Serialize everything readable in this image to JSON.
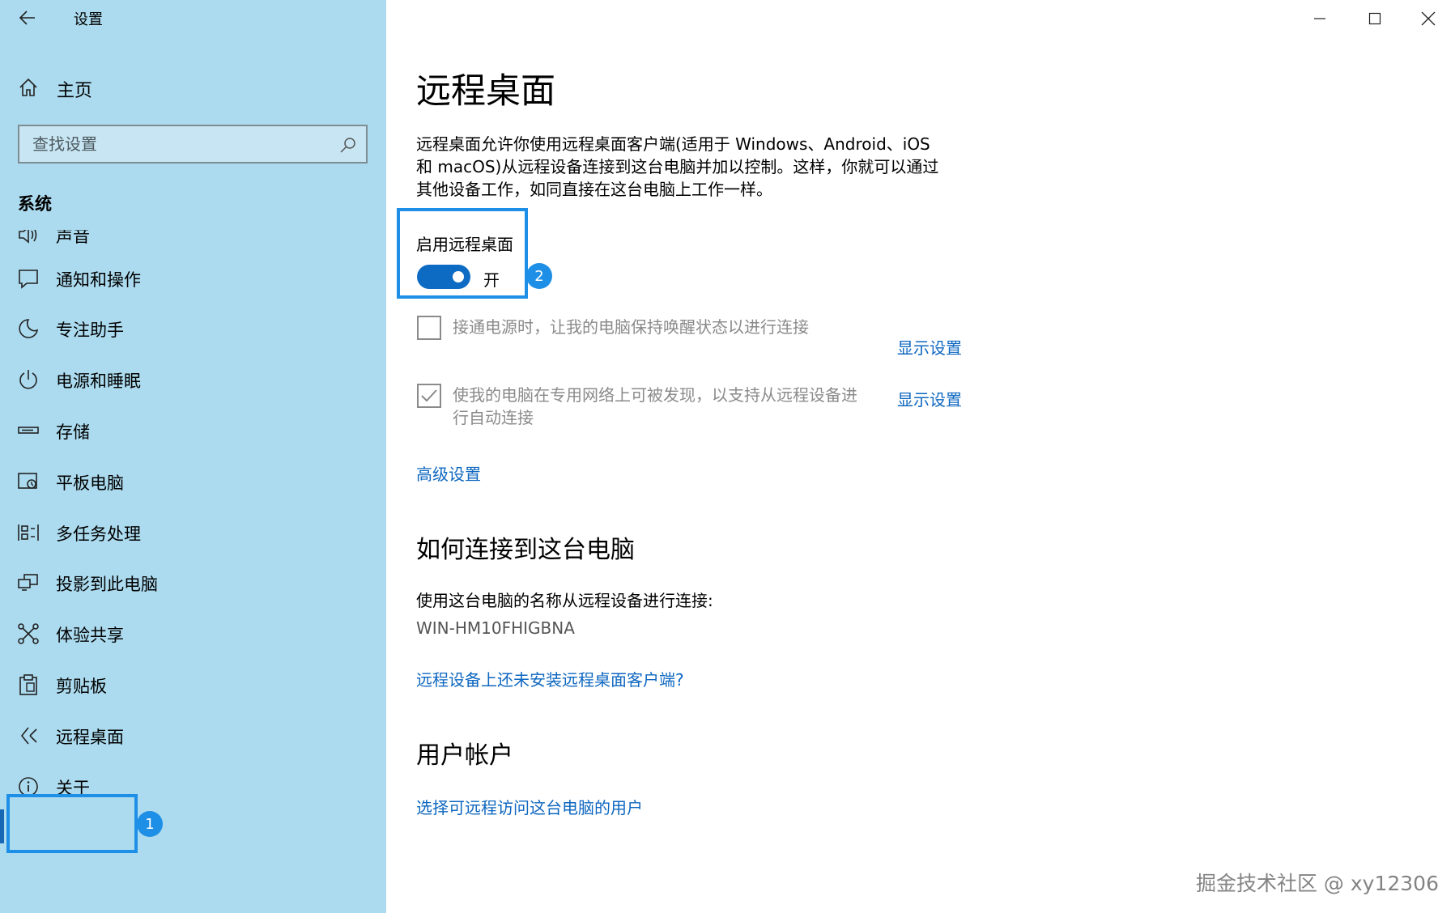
{
  "window": {
    "title": "设置",
    "controls": [
      "minimize-icon",
      "maximize-icon",
      "close-icon"
    ]
  },
  "sidebar": {
    "home_label": "主页",
    "search": {
      "placeholder": "查找设置",
      "value": ""
    },
    "section_label": "系统",
    "items": [
      {
        "label": "声音",
        "icon": "speaker-icon"
      },
      {
        "label": "通知和操作",
        "icon": "notification-icon"
      },
      {
        "label": "专注助手",
        "icon": "moon-icon"
      },
      {
        "label": "电源和睡眠",
        "icon": "power-icon"
      },
      {
        "label": "存储",
        "icon": "storage-icon"
      },
      {
        "label": "平板电脑",
        "icon": "tablet-icon"
      },
      {
        "label": "多任务处理",
        "icon": "multitask-icon"
      },
      {
        "label": "投影到此电脑",
        "icon": "project-icon"
      },
      {
        "label": "体验共享",
        "icon": "share-icon"
      },
      {
        "label": "剪贴板",
        "icon": "clipboard-icon"
      },
      {
        "label": "远程桌面",
        "icon": "remote-desktop-icon",
        "selected": true
      },
      {
        "label": "关于",
        "icon": "info-icon"
      }
    ],
    "step_badge": "1"
  },
  "main": {
    "title": "远程桌面",
    "description_lines": [
      "远程桌面允许你使用远程桌面客户端(适用于 Windows、Android、iOS",
      "和 macOS)从远程设备连接到这台电脑并加以控制。这样，你就可以通过",
      "其他设备工作，如同直接在这台电脑上工作一样。"
    ],
    "toggle": {
      "label": "启用远程桌面",
      "state_text": "开",
      "on": true
    },
    "step_badge": "2",
    "options": [
      {
        "lines": [
          "接通电源时，让我的电脑保持唤醒状态以进行连接"
        ],
        "checked": false,
        "link": "显示设置"
      },
      {
        "lines": [
          "使我的电脑在专用网络上可被发现，以支持从远程设备进",
          "行自动连接"
        ],
        "checked": true,
        "link": "显示设置"
      }
    ],
    "advanced_link": "高级设置",
    "connect": {
      "heading": "如何连接到这台电脑",
      "instruction": "使用这台电脑的名称从远程设备进行连接:",
      "pc_name": "WIN-HM10FHIGBNA",
      "client_link": "远程设备上还未安装远程桌面客户端?"
    },
    "accounts": {
      "heading": "用户帐户",
      "link": "选择可远程访问这台电脑的用户"
    }
  },
  "watermark": "掘金技术社区 @ xy12306",
  "colors": {
    "sidebar_bg": "#acdbef",
    "accent": "#0e6bc4",
    "highlight": "#1e8fe6",
    "link": "#0e67c0"
  }
}
